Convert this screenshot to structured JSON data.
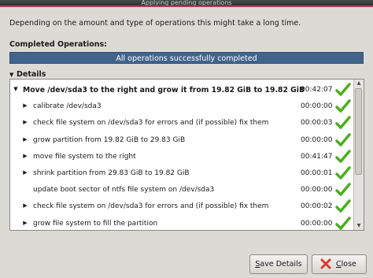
{
  "window": {
    "title": "Applying pending operations"
  },
  "intro_text": "Depending on the amount and type of operations this might take a long time.",
  "completed_label": "Completed Operations:",
  "progress": {
    "text": "All operations successfully completed",
    "fraction": 1.0
  },
  "details_label": "Details",
  "tree": {
    "rows": [
      {
        "text": "Move /dev/sda3 to the right and grow it from 19.82 GiB to 19.82 GiB",
        "time": "00:42:07",
        "expander": "expanded",
        "level": 0
      },
      {
        "text": "calibrate /dev/sda3",
        "time": "00:00:00",
        "expander": "collapsed",
        "level": 1
      },
      {
        "text": "check file system on /dev/sda3 for errors and (if possible) fix them",
        "time": "00:00:03",
        "expander": "collapsed",
        "level": 1
      },
      {
        "text": "grow partition from 19.82 GiB to 29.83 GiB",
        "time": "00:00:00",
        "expander": "collapsed",
        "level": 1
      },
      {
        "text": "move file system to the right",
        "time": "00:41:47",
        "expander": "collapsed",
        "level": 1
      },
      {
        "text": "shrink partition from 29.83 GiB to 19.82 GiB",
        "time": "00:00:01",
        "expander": "collapsed",
        "level": 1
      },
      {
        "text": "update boot sector of ntfs file system on /dev/sda3",
        "time": "00:00:00",
        "expander": "none",
        "level": 1
      },
      {
        "text": "check file system on /dev/sda3 for errors and (if possible) fix them",
        "time": "00:00:02",
        "expander": "collapsed",
        "level": 1
      },
      {
        "text": "grow file system to fill the partition",
        "time": "00:00:00",
        "expander": "collapsed",
        "level": 1
      }
    ],
    "status_icon": "check-icon"
  },
  "buttons": {
    "save_details": {
      "label": "Save Details",
      "mnemonic": "S"
    },
    "close": {
      "label": "Close",
      "mnemonic": "C",
      "icon": "close-icon"
    }
  },
  "colors": {
    "progress": "#42648c",
    "check": "#4caf1f",
    "close_icon": "#d83a2c"
  }
}
